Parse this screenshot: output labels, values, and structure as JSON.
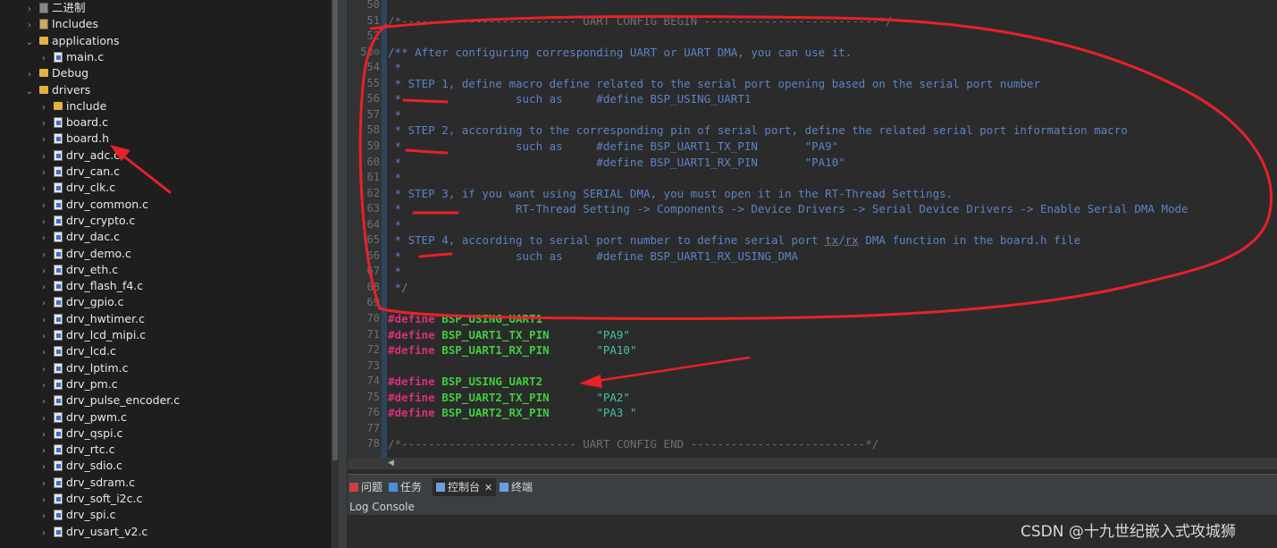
{
  "tree": {
    "items": [
      {
        "label": "二进制",
        "icon": "binaries-icon",
        "indent": 0
      },
      {
        "label": "Includes",
        "icon": "includes-icon",
        "indent": 0
      },
      {
        "label": "applications",
        "icon": "folder-icon",
        "indent": 0,
        "expanded": true
      },
      {
        "label": "main.c",
        "icon": "c-file-icon",
        "indent": 1
      },
      {
        "label": "Debug",
        "icon": "folder-icon",
        "indent": 0
      },
      {
        "label": "drivers",
        "icon": "folder-icon",
        "indent": 0,
        "expanded": true
      },
      {
        "label": "include",
        "icon": "folder-icon",
        "indent": 1
      },
      {
        "label": "board.c",
        "icon": "c-file-icon",
        "indent": 1
      },
      {
        "label": "board.h",
        "icon": "h-file-icon",
        "indent": 1
      },
      {
        "label": "drv_adc.c",
        "icon": "c-file-icon",
        "indent": 1
      },
      {
        "label": "drv_can.c",
        "icon": "c-file-icon",
        "indent": 1
      },
      {
        "label": "drv_clk.c",
        "icon": "c-file-icon",
        "indent": 1
      },
      {
        "label": "drv_common.c",
        "icon": "c-file-icon",
        "indent": 1
      },
      {
        "label": "drv_crypto.c",
        "icon": "c-file-icon",
        "indent": 1
      },
      {
        "label": "drv_dac.c",
        "icon": "c-file-icon",
        "indent": 1
      },
      {
        "label": "drv_demo.c",
        "icon": "c-file-icon",
        "indent": 1
      },
      {
        "label": "drv_eth.c",
        "icon": "c-file-icon",
        "indent": 1
      },
      {
        "label": "drv_flash_f4.c",
        "icon": "c-file-icon",
        "indent": 1
      },
      {
        "label": "drv_gpio.c",
        "icon": "c-file-icon",
        "indent": 1
      },
      {
        "label": "drv_hwtimer.c",
        "icon": "c-file-icon",
        "indent": 1
      },
      {
        "label": "drv_lcd_mipi.c",
        "icon": "c-file-icon",
        "indent": 1
      },
      {
        "label": "drv_lcd.c",
        "icon": "c-file-icon",
        "indent": 1
      },
      {
        "label": "drv_lptim.c",
        "icon": "c-file-icon",
        "indent": 1
      },
      {
        "label": "drv_pm.c",
        "icon": "c-file-icon",
        "indent": 1
      },
      {
        "label": "drv_pulse_encoder.c",
        "icon": "c-file-icon",
        "indent": 1
      },
      {
        "label": "drv_pwm.c",
        "icon": "c-file-icon",
        "indent": 1
      },
      {
        "label": "drv_qspi.c",
        "icon": "c-file-icon",
        "indent": 1
      },
      {
        "label": "drv_rtc.c",
        "icon": "c-file-icon",
        "indent": 1
      },
      {
        "label": "drv_sdio.c",
        "icon": "c-file-icon",
        "indent": 1
      },
      {
        "label": "drv_sdram.c",
        "icon": "c-file-icon",
        "indent": 1
      },
      {
        "label": "drv_soft_i2c.c",
        "icon": "c-file-icon",
        "indent": 1
      },
      {
        "label": "drv_spi.c",
        "icon": "c-file-icon",
        "indent": 1
      },
      {
        "label": "drv_usart_v2.c",
        "icon": "c-file-icon",
        "indent": 1
      }
    ]
  },
  "editor": {
    "lines": [
      {
        "n": "50",
        "segs": []
      },
      {
        "n": "51",
        "segs": [
          {
            "t": "/*-------------------------- UART CONFIG BEGIN --------------------------*/",
            "c": "cmt-dim"
          }
        ]
      },
      {
        "n": "52",
        "segs": []
      },
      {
        "n": "53⊖",
        "segs": [
          {
            "t": "/** After configuring corresponding UART or UART DMA, you can use it.",
            "c": "cmt"
          }
        ]
      },
      {
        "n": "54",
        "segs": [
          {
            "t": " *",
            "c": "cmt"
          }
        ]
      },
      {
        "n": "55",
        "segs": [
          {
            "t": " * STEP 1, define macro define related to the serial port opening based on the serial port number",
            "c": "cmt"
          }
        ]
      },
      {
        "n": "56",
        "segs": [
          {
            "t": " *                 such as     #define BSP_USING_UART1",
            "c": "cmt"
          }
        ]
      },
      {
        "n": "57",
        "segs": [
          {
            "t": " *",
            "c": "cmt"
          }
        ]
      },
      {
        "n": "58",
        "segs": [
          {
            "t": " * STEP 2, according to the corresponding pin of serial port, define the related serial port information macro",
            "c": "cmt"
          }
        ]
      },
      {
        "n": "59",
        "segs": [
          {
            "t": " *                 such as     #define BSP_UART1_TX_PIN       \"PA9\"",
            "c": "cmt"
          }
        ]
      },
      {
        "n": "60",
        "segs": [
          {
            "t": " *                             #define BSP_UART1_RX_PIN       \"PA10\"",
            "c": "cmt"
          }
        ]
      },
      {
        "n": "61",
        "segs": [
          {
            "t": " *",
            "c": "cmt"
          }
        ]
      },
      {
        "n": "62",
        "segs": [
          {
            "t": " * STEP 3, if you want using SERIAL DMA, you must open it in the RT-Thread Settings.",
            "c": "cmt"
          }
        ]
      },
      {
        "n": "63",
        "segs": [
          {
            "t": " *                 RT-Thread Setting -> Components -> Device Drivers -> Serial Device Drivers -> Enable Serial DMA Mode",
            "c": "cmt"
          }
        ]
      },
      {
        "n": "64",
        "segs": [
          {
            "t": " *",
            "c": "cmt"
          }
        ]
      },
      {
        "n": "65",
        "segs": [
          {
            "t": " * STEP 4, according to serial port number to define serial port ",
            "c": "cmt"
          },
          {
            "t": "tx",
            "c": "cmt dotted"
          },
          {
            "t": "/",
            "c": "cmt"
          },
          {
            "t": "rx",
            "c": "cmt dotted"
          },
          {
            "t": " DMA function in the board.h file",
            "c": "cmt"
          }
        ]
      },
      {
        "n": "66",
        "segs": [
          {
            "t": " *                 such as     #define BSP_UART1_RX_USING_DMA",
            "c": "cmt"
          }
        ]
      },
      {
        "n": "67",
        "segs": [
          {
            "t": " *",
            "c": "cmt"
          }
        ]
      },
      {
        "n": "68",
        "segs": [
          {
            "t": " */",
            "c": "cmt"
          }
        ]
      },
      {
        "n": "69",
        "segs": []
      },
      {
        "n": "70",
        "segs": [
          {
            "t": "#define",
            "c": "kw"
          },
          {
            "t": " ",
            "c": ""
          },
          {
            "t": "BSP_USING_UART1",
            "c": "mac"
          }
        ]
      },
      {
        "n": "71",
        "segs": [
          {
            "t": "#define",
            "c": "kw"
          },
          {
            "t": " ",
            "c": ""
          },
          {
            "t": "BSP_UART1_TX_PIN",
            "c": "mac"
          },
          {
            "t": "       ",
            "c": ""
          },
          {
            "t": "\"PA9\"",
            "c": "str"
          }
        ]
      },
      {
        "n": "72",
        "segs": [
          {
            "t": "#define",
            "c": "kw"
          },
          {
            "t": " ",
            "c": ""
          },
          {
            "t": "BSP_UART1_RX_PIN",
            "c": "mac"
          },
          {
            "t": "       ",
            "c": ""
          },
          {
            "t": "\"PA10\"",
            "c": "str"
          }
        ]
      },
      {
        "n": "73",
        "segs": []
      },
      {
        "n": "74",
        "segs": [
          {
            "t": "#define",
            "c": "kw"
          },
          {
            "t": " ",
            "c": ""
          },
          {
            "t": "BSP_USING_UART2",
            "c": "mac"
          }
        ]
      },
      {
        "n": "75",
        "segs": [
          {
            "t": "#define",
            "c": "kw"
          },
          {
            "t": " ",
            "c": ""
          },
          {
            "t": "BSP_UART2_TX_PIN",
            "c": "mac"
          },
          {
            "t": "       ",
            "c": ""
          },
          {
            "t": "\"PA2\"",
            "c": "str"
          }
        ]
      },
      {
        "n": "76",
        "segs": [
          {
            "t": "#define",
            "c": "kw"
          },
          {
            "t": " ",
            "c": ""
          },
          {
            "t": "BSP_UART2_RX_PIN",
            "c": "mac"
          },
          {
            "t": "       ",
            "c": ""
          },
          {
            "t": "\"PA3 \"",
            "c": "str"
          }
        ]
      },
      {
        "n": "77",
        "segs": []
      },
      {
        "n": "78",
        "segs": [
          {
            "t": "/*-------------------------- UART CONFIG END --------------------------*/",
            "c": "cmt-dim"
          }
        ]
      }
    ]
  },
  "panel": {
    "tabs": [
      {
        "label": "问题",
        "icon": "problems-icon",
        "active": false
      },
      {
        "label": "任务",
        "icon": "tasks-icon",
        "active": false
      },
      {
        "label": "控制台",
        "icon": "console-icon",
        "active": true,
        "close": "✕"
      },
      {
        "label": "终端",
        "icon": "terminal-icon",
        "active": false
      }
    ],
    "console_title": "Log Console"
  },
  "watermark": "CSDN @十九世纪嵌入式攻城狮",
  "colors": {
    "annotation": "#e8212a",
    "comment": "#5a84c7",
    "keyword": "#d8307a",
    "macro": "#3fce3f",
    "string": "#3fc4a6"
  }
}
